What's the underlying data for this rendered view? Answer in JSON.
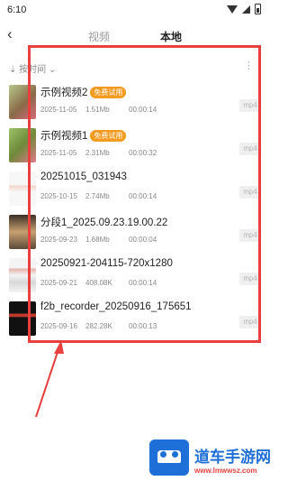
{
  "status_bar": {
    "time": "6:10"
  },
  "header": {
    "back_icon": "‹",
    "tabs": [
      {
        "label": "视频"
      },
      {
        "label": "本地"
      }
    ]
  },
  "sort": {
    "label": "按时间",
    "chevron": "⌄",
    "more": "⋮"
  },
  "files": [
    {
      "name": "示例视频2",
      "badge": "免费试用",
      "date": "2025-11-05",
      "size": "1.51Mb",
      "duration": "00:00:14",
      "ext": "mp4"
    },
    {
      "name": "示例视频1",
      "badge": "免费试用",
      "date": "2025-11-05",
      "size": "2.31Mb",
      "duration": "00:00:32",
      "ext": "mp4"
    },
    {
      "name": "20251015_031943",
      "badge": "",
      "date": "2025-10-15",
      "size": "2.74Mb",
      "duration": "00:00:14",
      "ext": "mp4"
    },
    {
      "name": "分段1_2025.09.23.19.00.22",
      "badge": "",
      "date": "2025-09-23",
      "size": "1.68Mb",
      "duration": "00:00:04",
      "ext": "mp4"
    },
    {
      "name": "20250921-204115-720x1280",
      "badge": "",
      "date": "2025-09-21",
      "size": "408.08K",
      "duration": "00:00:14",
      "ext": "mp4"
    },
    {
      "name": "f2b_recorder_20250916_175651",
      "badge": "",
      "date": "2025-09-16",
      "size": "282.28K",
      "duration": "00:00:13",
      "ext": "mp4"
    }
  ],
  "watermark": {
    "name": "道车手游网",
    "url": "www.lmwwsz.com"
  },
  "colors": {
    "accent": "#f39a1f",
    "highlight": "#e8403f",
    "brand": "#1e6fd8"
  }
}
